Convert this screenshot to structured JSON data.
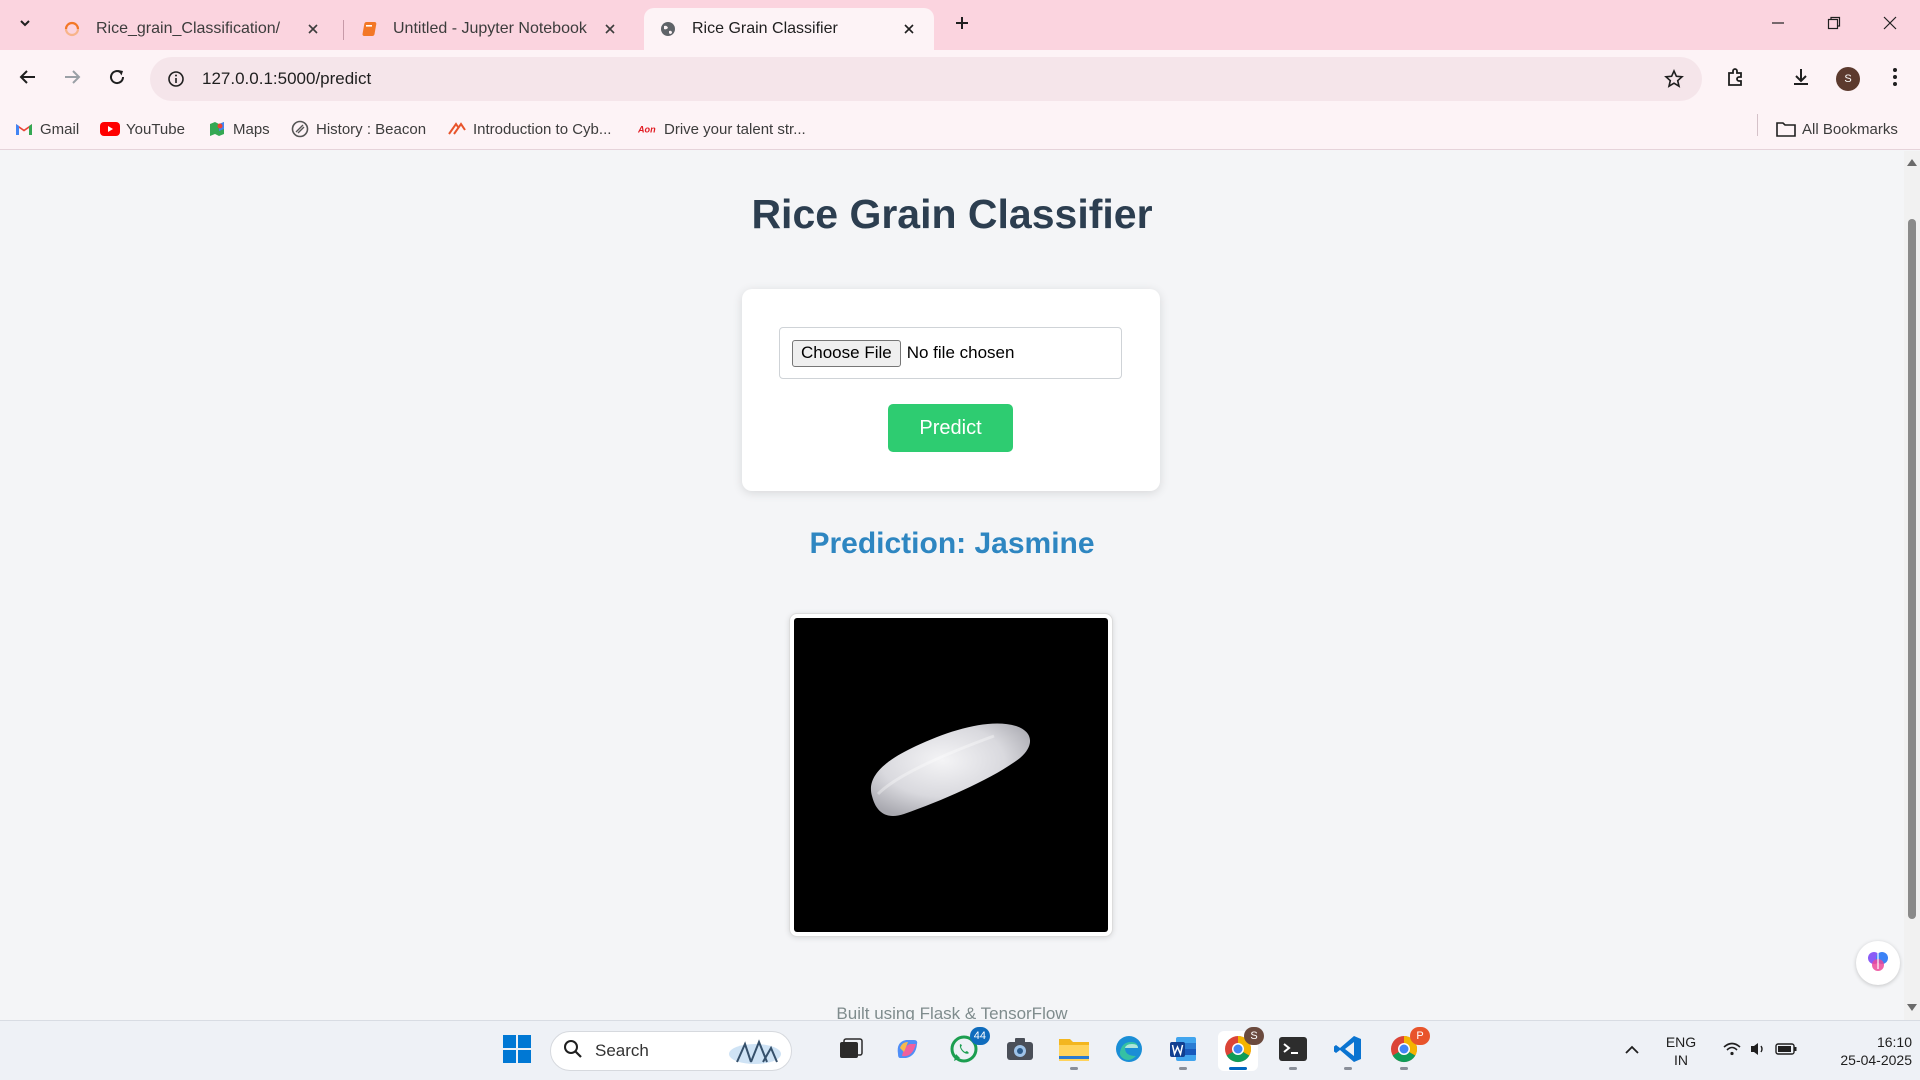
{
  "browser": {
    "tabs": [
      {
        "title": "Rice_grain_Classification/",
        "active": false
      },
      {
        "title": "Untitled - Jupyter Notebook",
        "active": false
      },
      {
        "title": "Rice Grain Classifier",
        "active": true
      }
    ],
    "url": "127.0.0.1:5000/predict",
    "profile_initial": "S",
    "bookmarks": [
      {
        "label": "Gmail",
        "icon": "gmail-icon"
      },
      {
        "label": "YouTube",
        "icon": "youtube-icon"
      },
      {
        "label": "Maps",
        "icon": "maps-icon"
      },
      {
        "label": "History : Beacon",
        "icon": "beacon-icon"
      },
      {
        "label": "Introduction to Cyb...",
        "icon": "cyber-icon"
      },
      {
        "label": "Drive your talent str...",
        "icon": "aon-icon"
      }
    ],
    "all_bookmarks_label": "All Bookmarks",
    "accent": "#fbd4df"
  },
  "page": {
    "title": "Rice Grain Classifier",
    "file_input": {
      "button_label": "Choose File",
      "status": "No file chosen"
    },
    "predict_label": "Predict",
    "prediction_text": "Prediction: Jasmine",
    "footer": "Built using Flask & TensorFlow",
    "colors": {
      "predict_button": "#2ecc71",
      "prediction": "#2e86c1",
      "title": "#2c3e50"
    }
  },
  "taskbar": {
    "search_label": "Search",
    "whatsapp_badge": "44",
    "chrome_badge": "S",
    "chrome_profile2_badge": "P",
    "language": {
      "line1": "ENG",
      "line2": "IN"
    },
    "time": "16:10",
    "date": "25-04-2025"
  }
}
